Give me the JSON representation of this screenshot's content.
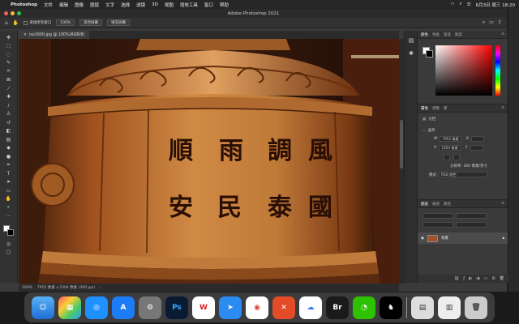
{
  "menubar": {
    "app_name": "Photoshop",
    "items": [
      "文件",
      "编辑",
      "图像",
      "图层",
      "文字",
      "选择",
      "滤镜",
      "3D",
      "视图",
      "增效工具",
      "窗口",
      "帮助"
    ],
    "datetime": "6月3日 周三 18:20"
  },
  "window": {
    "title": "Adobe Photoshop 2021"
  },
  "options": {
    "scroll_all_label": "滚动所有窗口",
    "zoom_value": "100%",
    "fit_screen_label": "适合屏幕",
    "fill_screen_label": "填充屏幕"
  },
  "document": {
    "tab_title": "iso1600.jpg @ 100%(RGB/8)",
    "status_zoom": "100%",
    "status_info": "7952 像素 x 5304 像素 (300 ppi)"
  },
  "artwork": {
    "inscription_row1": [
      "順",
      "雨",
      "調",
      "風"
    ],
    "inscription_row2": [
      "安",
      "民",
      "泰",
      "國"
    ]
  },
  "panels": {
    "color_tabs": [
      "颜色",
      "色板",
      "渐变",
      "图案"
    ],
    "props_tabs": [
      "属性",
      "调整",
      "库"
    ],
    "doc_label": "文档",
    "canvas_label": "画布",
    "width_label": "W",
    "width_value": "7952 像素",
    "height_label": "H",
    "height_value": "5304 像素",
    "x_label": "X",
    "y_label": "Y",
    "resolution": "分辨率: 300 像素/英寸",
    "mode_label": "模式",
    "mode_value": "RGB 颜色",
    "layers_tabs": [
      "图层",
      "通道",
      "路径"
    ],
    "layer_name": "背景"
  },
  "colors": {
    "accent": "#1473e6"
  }
}
